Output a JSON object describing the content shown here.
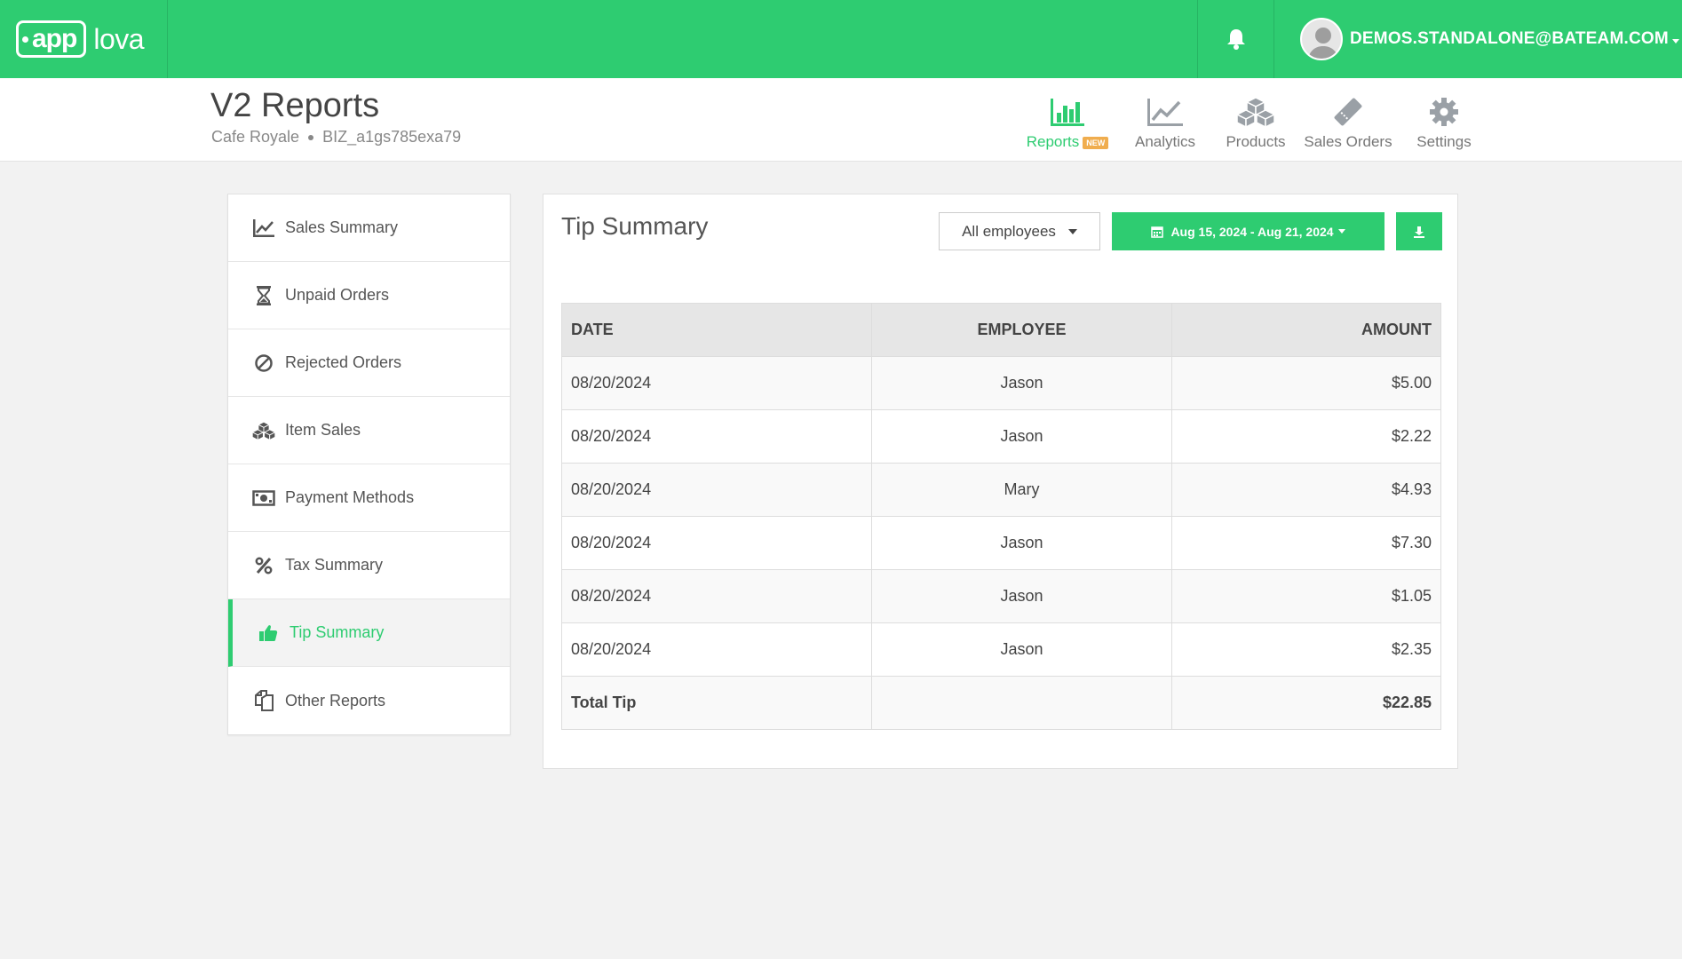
{
  "brand": {
    "logo_app": "app",
    "logo_lova": "lova",
    "accent": "#2ecc71"
  },
  "user": {
    "email": "DEMOS.STANDALONE@BATEAM.COM"
  },
  "header": {
    "title": "V2 Reports",
    "business_name": "Cafe Royale",
    "business_id": "BIZ_a1gs785exa79"
  },
  "topnav": [
    {
      "label": "Reports",
      "badge": "NEW",
      "icon": "bar-chart-icon",
      "active": true
    },
    {
      "label": "Analytics",
      "icon": "line-chart-icon"
    },
    {
      "label": "Products",
      "icon": "cubes-icon"
    },
    {
      "label": "Sales Orders",
      "icon": "ticket-icon"
    },
    {
      "label": "Settings",
      "icon": "gear-icon"
    }
  ],
  "sidebar": {
    "items": [
      {
        "label": "Sales Summary",
        "icon": "line-chart-icon"
      },
      {
        "label": "Unpaid Orders",
        "icon": "hourglass-icon"
      },
      {
        "label": "Rejected Orders",
        "icon": "ban-icon"
      },
      {
        "label": "Item Sales",
        "icon": "cubes-icon"
      },
      {
        "label": "Payment Methods",
        "icon": "money-icon"
      },
      {
        "label": "Tax Summary",
        "icon": "percent-icon"
      },
      {
        "label": "Tip Summary",
        "icon": "thumbs-up-icon",
        "active": true
      },
      {
        "label": "Other Reports",
        "icon": "copy-icon"
      }
    ]
  },
  "main": {
    "title": "Tip Summary",
    "employee_filter": "All employees",
    "date_range": "Aug 15, 2024 - Aug 21, 2024",
    "columns": [
      "DATE",
      "EMPLOYEE",
      "AMOUNT"
    ],
    "rows": [
      {
        "date": "08/20/2024",
        "employee": "Jason",
        "amount": "$5.00"
      },
      {
        "date": "08/20/2024",
        "employee": "Jason",
        "amount": "$2.22"
      },
      {
        "date": "08/20/2024",
        "employee": "Mary",
        "amount": "$4.93"
      },
      {
        "date": "08/20/2024",
        "employee": "Jason",
        "amount": "$7.30"
      },
      {
        "date": "08/20/2024",
        "employee": "Jason",
        "amount": "$1.05"
      },
      {
        "date": "08/20/2024",
        "employee": "Jason",
        "amount": "$2.35"
      }
    ],
    "total": {
      "label": "Total Tip",
      "amount": "$22.85"
    }
  }
}
